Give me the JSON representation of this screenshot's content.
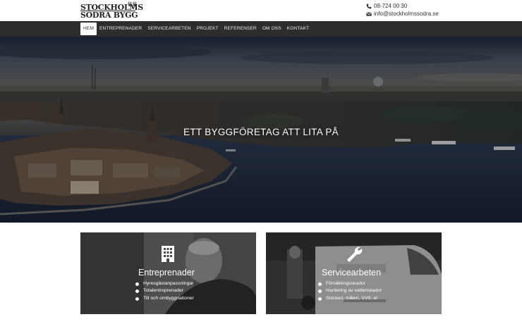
{
  "logo": {
    "line1": "STOCKHOLMS",
    "line2": "SÖDRA BYGG",
    "crown": "♛♛"
  },
  "contact": {
    "phone": "08-724 00 30",
    "email": "info@stockholmssodra.se",
    "phone_icon": "phone-icon",
    "email_icon": "envelope-icon"
  },
  "nav": {
    "items": [
      {
        "label": "HEM"
      },
      {
        "label": "ENTREPRENADER"
      },
      {
        "label": "SERVICEARBETEN"
      },
      {
        "label": "PROJEKT"
      },
      {
        "label": "REFERENSER"
      },
      {
        "label": "OM OSS"
      },
      {
        "label": "KONTAKT"
      }
    ],
    "active_index": 0
  },
  "hero": {
    "title": "ETT BYGGFÖRETAG ATT LITA PÅ"
  },
  "cards": [
    {
      "title": "Entreprenader",
      "icon": "building-icon",
      "items": [
        "Hyresgästanpassningar",
        "Totalentreprenader",
        "Till och ombyggnationer"
      ]
    },
    {
      "title": "Servicearbeten",
      "icon": "wrench-icon",
      "items": [
        "Försäkringsskador",
        "Hantering av vattenskador",
        "Snickeri, måleri, VVS, el"
      ]
    }
  ],
  "colors": {
    "nav_bg": "#2d2d2d",
    "text_dark": "#333333",
    "white": "#ffffff"
  }
}
